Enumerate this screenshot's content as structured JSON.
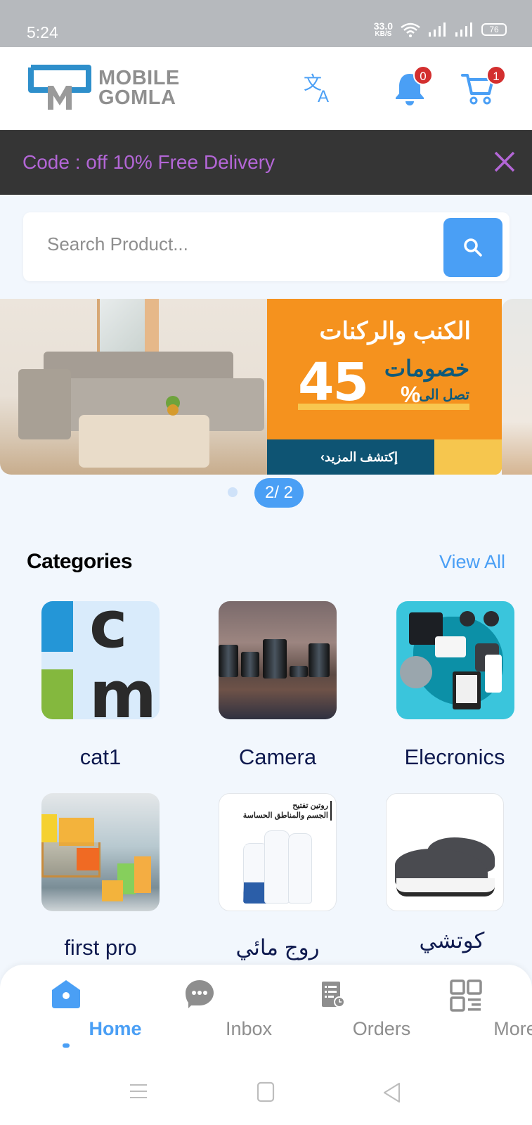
{
  "status_bar": {
    "time": "5:24",
    "net_speed_value": "33.0",
    "net_speed_unit": "KB/S",
    "battery": "76"
  },
  "header": {
    "logo_line1": "MOBILE",
    "logo_line2": "GOMLA",
    "icons": [
      "translate-icon",
      "bell-icon",
      "cart-icon"
    ],
    "notifications_count": "0",
    "cart_count": "1",
    "accent_color": "#4a9ff5",
    "badge_color": "#d32f2f"
  },
  "promo_bar": {
    "text": "Code : off 10% Free Delivery",
    "text_color": "#b366d6",
    "close_icon": "close-icon"
  },
  "search": {
    "placeholder": "Search Product...",
    "value": ""
  },
  "banner": {
    "title": "الكنب والركنات",
    "subtitle": "خصومات",
    "upto": "تصل الى",
    "percent": "45",
    "percent_sign": "%",
    "cta": "إكتشف المزيد›",
    "page_indicator": "2/ 2",
    "current_page": 2,
    "total_pages": 2
  },
  "categories": {
    "title": "Categories",
    "view_all": "View All",
    "items": [
      {
        "label": "cat1"
      },
      {
        "label": "Camera"
      },
      {
        "label": "Elecronics"
      },
      {
        "label": "first pro"
      },
      {
        "label": "روج مائي",
        "image_text_line1": "روتين تفتيح",
        "image_text_line2": "الجسم والمناطق الحساسة"
      },
      {
        "label": "كوتشي"
      }
    ]
  },
  "bottom_nav": {
    "items": [
      {
        "label": "Home",
        "icon": "home-icon",
        "active": true
      },
      {
        "label": "Inbox",
        "icon": "chat-icon",
        "active": false
      },
      {
        "label": "Orders",
        "icon": "orders-icon",
        "active": false
      },
      {
        "label": "More",
        "icon": "grid-icon",
        "active": false
      }
    ]
  },
  "system_nav": [
    "menu-icon",
    "home-square-icon",
    "back-icon"
  ]
}
